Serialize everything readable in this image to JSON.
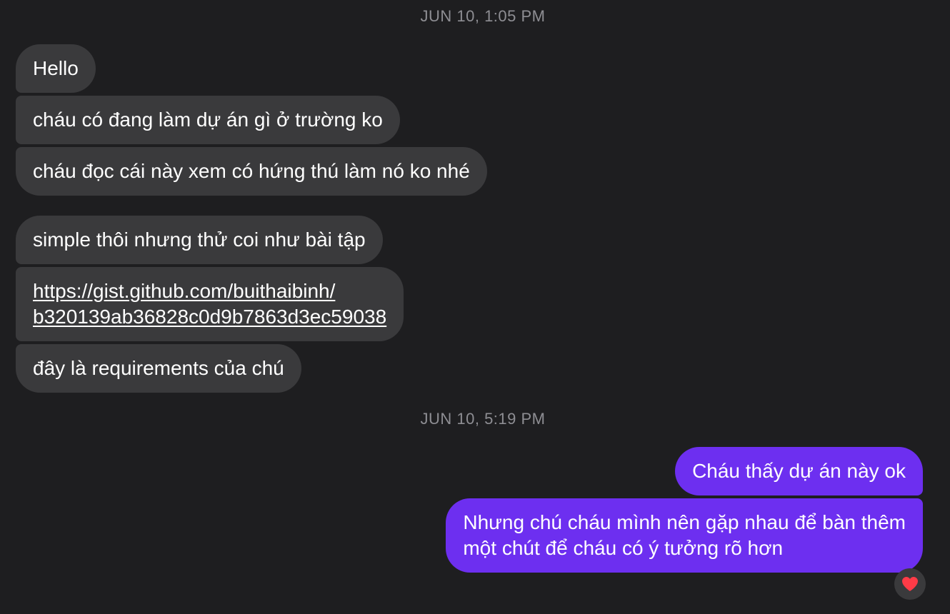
{
  "timestamps": [
    "JUN 10, 1:05 PM",
    "JUN 10, 5:19 PM"
  ],
  "incoming": [
    "Hello",
    "cháu có đang làm dự án gì ở trường ko",
    "cháu đọc cái này xem có hứng thú làm nó ko nhé",
    "simple thôi nhưng thử coi như bài tập",
    {
      "line1": "https://gist.github.com/buithaibinh/",
      "line2": "b320139ab36828c0d9b7863d3ec59038"
    },
    "đây là requirements của chú"
  ],
  "outgoing": [
    "Cháu thấy dự án này ok",
    {
      "line1": "Nhưng chú cháu mình nên gặp nhau để bàn thêm",
      "line2": "một chút để cháu có ý tưởng rõ hơn"
    }
  ],
  "reaction": {
    "icon": "heart-icon",
    "color": "#ff3b47"
  },
  "colors": {
    "background": "#1e1e20",
    "incoming": "#3a3a3c",
    "outgoing": "#6d2ff0"
  }
}
